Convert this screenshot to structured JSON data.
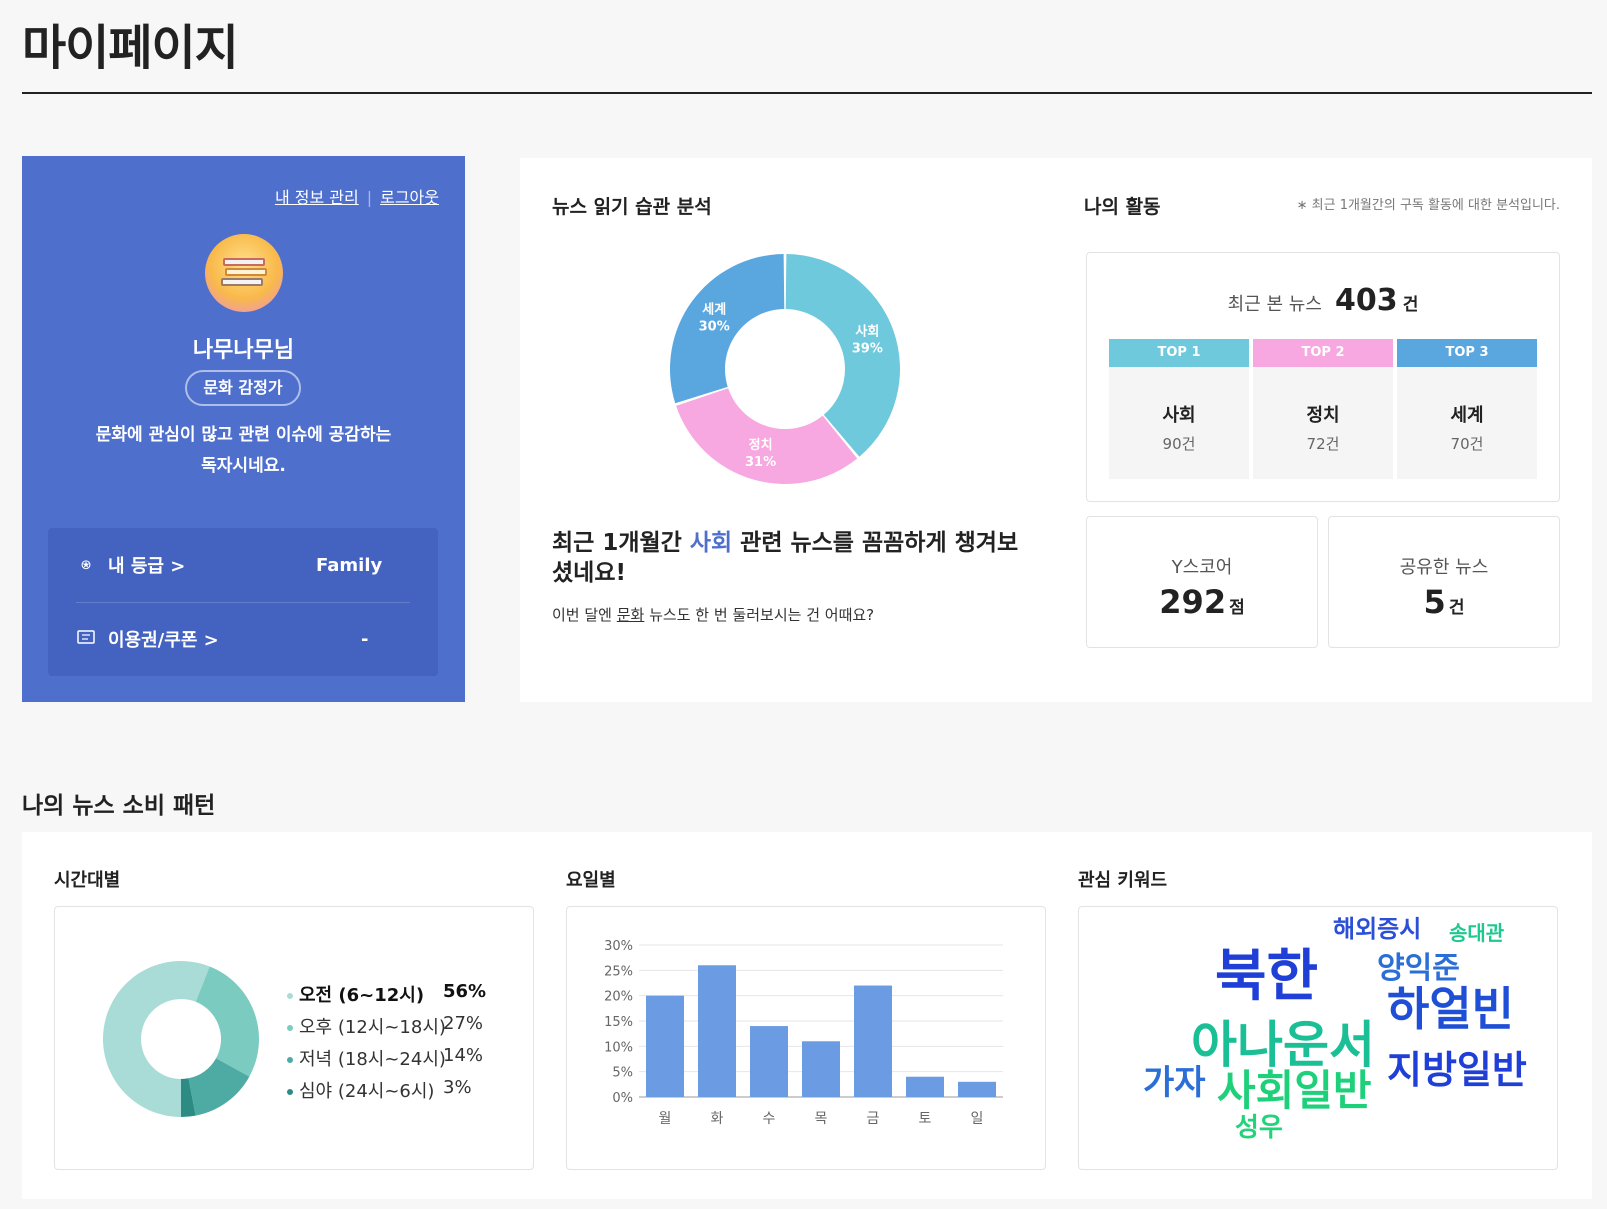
{
  "page": {
    "title": "마이페이지"
  },
  "profile": {
    "links": {
      "manage": "내 정보 관리",
      "logout": "로그아웃"
    },
    "nickname": "나무나무님",
    "badge": "문화 감정가",
    "description_line1": "문화에 관심이 많고 관련 이슈에 공감하는",
    "description_line2": "독자시네요.",
    "grade_label": "내 등급 >",
    "grade_value": "Family",
    "coupon_label": "이용권/쿠폰 >",
    "coupon_value": "-"
  },
  "reading": {
    "title": "뉴스 읽기 습관 분석",
    "chart_data": {
      "type": "pie",
      "categories": [
        "사회",
        "정치",
        "세계"
      ],
      "values": [
        39,
        31,
        30
      ],
      "labels": [
        "사회 39%",
        "정치 31%",
        "세계 30%"
      ],
      "colors": [
        "#6fc9dc",
        "#f7a8e0",
        "#5aa7e0"
      ]
    },
    "message_pre": "최근 1개월간 ",
    "message_highlight": "사회",
    "message_post": " 관련 뉴스를 꼼꼼하게 챙겨보",
    "message_line2": "셨네요!",
    "suggest_pre": "이번 달엔 ",
    "suggest_link": "문화",
    "suggest_post": " 뉴스도 한 번 둘러보시는 건 어때요?"
  },
  "activity": {
    "title": "나의 활동",
    "note": "∗ 최근 1개월간의 구독 활동에 대한 분석입니다.",
    "recent_label": "최근 본 뉴스",
    "recent_count": "403",
    "recent_unit": "건",
    "top": [
      {
        "label": "TOP 1",
        "category": "사회",
        "count": "90건",
        "color": "#6fc9dc"
      },
      {
        "label": "TOP 2",
        "category": "정치",
        "count": "72건",
        "color": "#f7a8e0"
      },
      {
        "label": "TOP 3",
        "category": "세계",
        "count": "70건",
        "color": "#5aa7e0"
      }
    ],
    "score_label": "Y스코어",
    "score_value": "292",
    "score_unit": "점",
    "shared_label": "공유한 뉴스",
    "shared_value": "5",
    "shared_unit": "건"
  },
  "pattern": {
    "title": "나의 뉴스 소비 패턴",
    "time": {
      "title": "시간대별",
      "chart_data": {
        "type": "pie",
        "categories": [
          "오전 (6~12시)",
          "오후 (12시~18시)",
          "저녁 (18시~24시)",
          "심야 (24시~6시)"
        ],
        "values": [
          56,
          27,
          14,
          3
        ],
        "colors": [
          "#a9dcd6",
          "#7ccbc1",
          "#4eaba4",
          "#2c8c84"
        ]
      },
      "legend": [
        {
          "label": "오전 (6~12시)",
          "pct": "56%"
        },
        {
          "label": "오후 (12시~18시)",
          "pct": "27%"
        },
        {
          "label": "저녁 (18시~24시)",
          "pct": "14%"
        },
        {
          "label": "심야 (24시~6시)",
          "pct": "3%"
        }
      ]
    },
    "weekday": {
      "title": "요일별",
      "chart_data": {
        "type": "bar",
        "categories": [
          "월",
          "화",
          "수",
          "목",
          "금",
          "토",
          "일"
        ],
        "values": [
          20,
          26,
          14,
          11,
          22,
          4,
          3
        ],
        "ylim": [
          0,
          30
        ],
        "yticks": [
          "0%",
          "5%",
          "10%",
          "15%",
          "20%",
          "25%",
          "30%"
        ],
        "color": "#6a9be3",
        "grid": true
      }
    },
    "keywords": {
      "title": "관심 키워드",
      "words": [
        {
          "text": "해외증시",
          "color": "#2b4fd6"
        },
        {
          "text": "송대관",
          "color": "#1ec88f"
        },
        {
          "text": "북한",
          "color": "#1f3fd6"
        },
        {
          "text": "양익준",
          "color": "#2b6fd6"
        },
        {
          "text": "하얼빈",
          "color": "#1f4fd6"
        },
        {
          "text": "아나운서",
          "color": "#1bbf95"
        },
        {
          "text": "가자",
          "color": "#2b6fd6"
        },
        {
          "text": "사회일반",
          "color": "#1ed07a"
        },
        {
          "text": "지방일반",
          "color": "#1f3fd6"
        },
        {
          "text": "성우",
          "color": "#22d37a"
        }
      ]
    }
  }
}
